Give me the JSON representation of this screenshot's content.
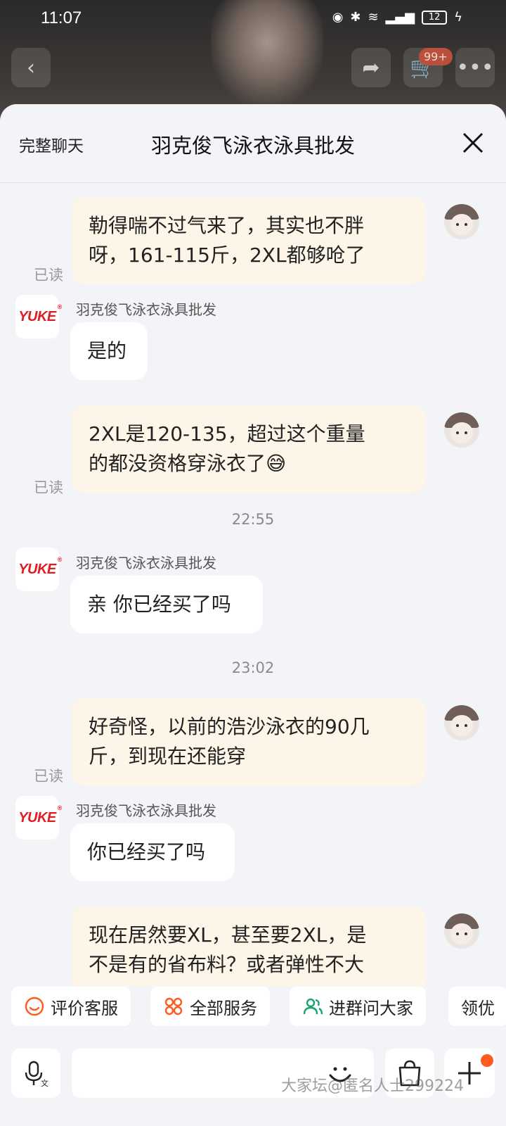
{
  "status_bar": {
    "time": "11:07",
    "battery": "12"
  },
  "top_nav": {
    "cart_badge": "99+"
  },
  "sheet": {
    "left_link": "完整聊天",
    "title": "羽克俊飞泳衣泳具批发"
  },
  "store_name": "羽克俊飞泳衣泳具批发",
  "store_logo_text": "YUKE",
  "read_label": "已读",
  "messages": [
    {
      "from": "me",
      "lines": [
        "勒得喘不过气来了，其实也不胖",
        "呀，161-115斤，2XL都够呛了"
      ]
    },
    {
      "from": "them",
      "lines": [
        "是的"
      ]
    },
    {
      "from": "me",
      "lines": [
        "2XL是120-135，超过这个重量",
        "的都没资格穿泳衣了😅"
      ]
    },
    {
      "time": "22:55"
    },
    {
      "from": "them",
      "lines": [
        "亲 你已经买了吗"
      ]
    },
    {
      "time": "23:02"
    },
    {
      "from": "me",
      "lines": [
        "好奇怪，以前的浩沙泳衣的90几",
        "斤，到现在还能穿"
      ]
    },
    {
      "from": "them",
      "lines": [
        "你已经买了吗"
      ]
    },
    {
      "from": "me",
      "lines": [
        "现在居然要XL，甚至要2XL，是",
        "不是有的省布料？或者弹性不大"
      ]
    }
  ],
  "quick_actions": [
    {
      "label": "评价客服",
      "icon": "smile-icon"
    },
    {
      "label": "全部服务",
      "icon": "grid-icon"
    },
    {
      "label": "进群问大家",
      "icon": "group-icon"
    },
    {
      "label": "领优",
      "icon": ""
    }
  ],
  "input": {
    "placeholder": ""
  },
  "watermark": "大家坛@匿名人士299224",
  "colors": {
    "my_bubble": "#fdf5e7",
    "their_bubble": "#ffffff",
    "accent": "#ff5a1f",
    "logo_red": "#e11b22"
  }
}
